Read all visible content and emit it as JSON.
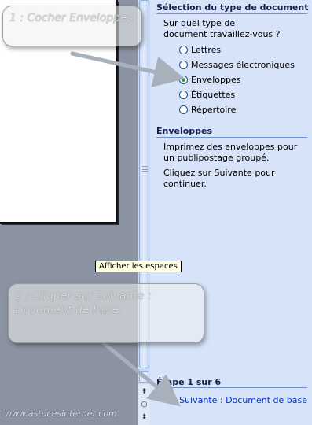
{
  "tooltip": {
    "text": "Afficher les espaces"
  },
  "task_pane": {
    "section1_title": "Sélection du type de document",
    "question": "Sur quel type de document travaillez-vous ?",
    "options": [
      {
        "label": "Lettres",
        "checked": false
      },
      {
        "label": "Messages électroniques",
        "checked": false
      },
      {
        "label": "Enveloppes",
        "checked": true
      },
      {
        "label": "Étiquettes",
        "checked": false
      },
      {
        "label": "Répertoire",
        "checked": false
      }
    ],
    "section2_title": "Enveloppes",
    "description": "Imprimez des enveloppes pour un publipostage groupé.",
    "instruction": "Cliquez sur Suivante pour continuer.",
    "step_title": "Étape 1 sur 6",
    "next_link": "Suivante : Document de base"
  },
  "annotations": {
    "callout1": "1 : Cocher Enveloppes",
    "callout2": "2 : Cliquer sur Suivante : Document de base."
  },
  "watermark": "www.astucesinternet.com",
  "icons": {
    "scroll_down": "scroll-down-arrow",
    "prev_page": "double-up-arrow",
    "browse_object": "circle-select",
    "next_arrow": "right-arrow"
  },
  "colors": {
    "task_pane_bg": "#d6e3f8",
    "link": "#0033cc",
    "checked_radio": "#21a121"
  }
}
